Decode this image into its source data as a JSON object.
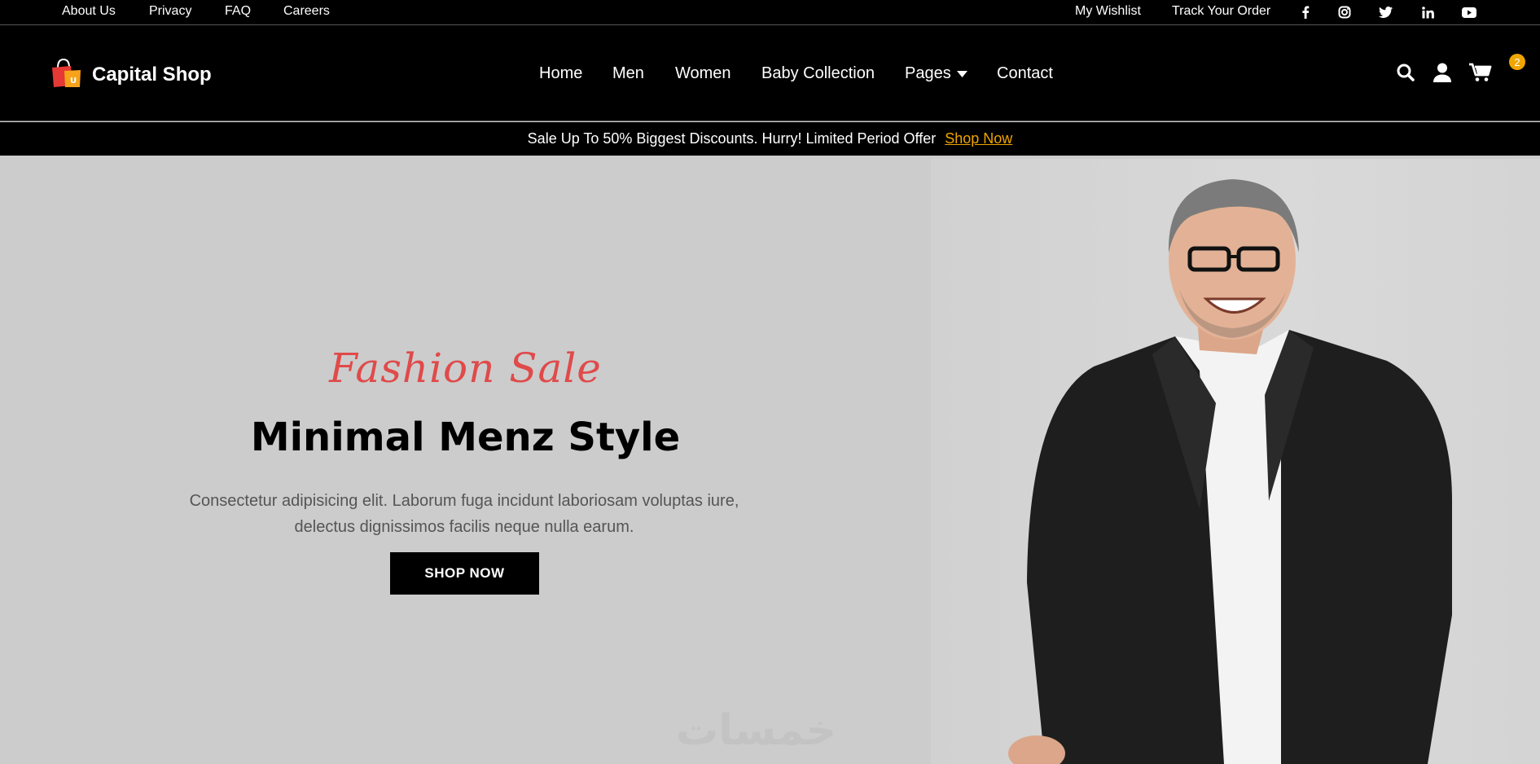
{
  "topbar": {
    "links": [
      "About Us",
      "Privacy",
      "FAQ",
      "Careers"
    ],
    "right_links": [
      "My Wishlist",
      "Track Your Order"
    ],
    "social_icons": [
      "facebook-icon",
      "instagram-icon",
      "twitter-icon",
      "linkedin-icon",
      "youtube-icon"
    ]
  },
  "header": {
    "brand": "Capital Shop",
    "nav": [
      "Home",
      "Men",
      "Women",
      "Baby Collection",
      "Pages",
      "Contact"
    ],
    "cart_count": "2"
  },
  "announcement": {
    "message": "Sale Up To 50% Biggest Discounts. Hurry! Limited Period Offer",
    "link": "Shop Now"
  },
  "hero": {
    "script_title": "Fashion Sale",
    "title": "Minimal Menz Style",
    "description": "Consectetur adipisicing elit. Laborum fuga incidunt laboriosam voluptas iure, delectus dignissimos facilis neque nulla earum.",
    "button": "SHOP NOW",
    "watermark": "خمسات"
  },
  "colors": {
    "accent": "#f0a500",
    "script": "#e04a4a",
    "bar": "#000000",
    "hero_bg": "#cccccc"
  }
}
